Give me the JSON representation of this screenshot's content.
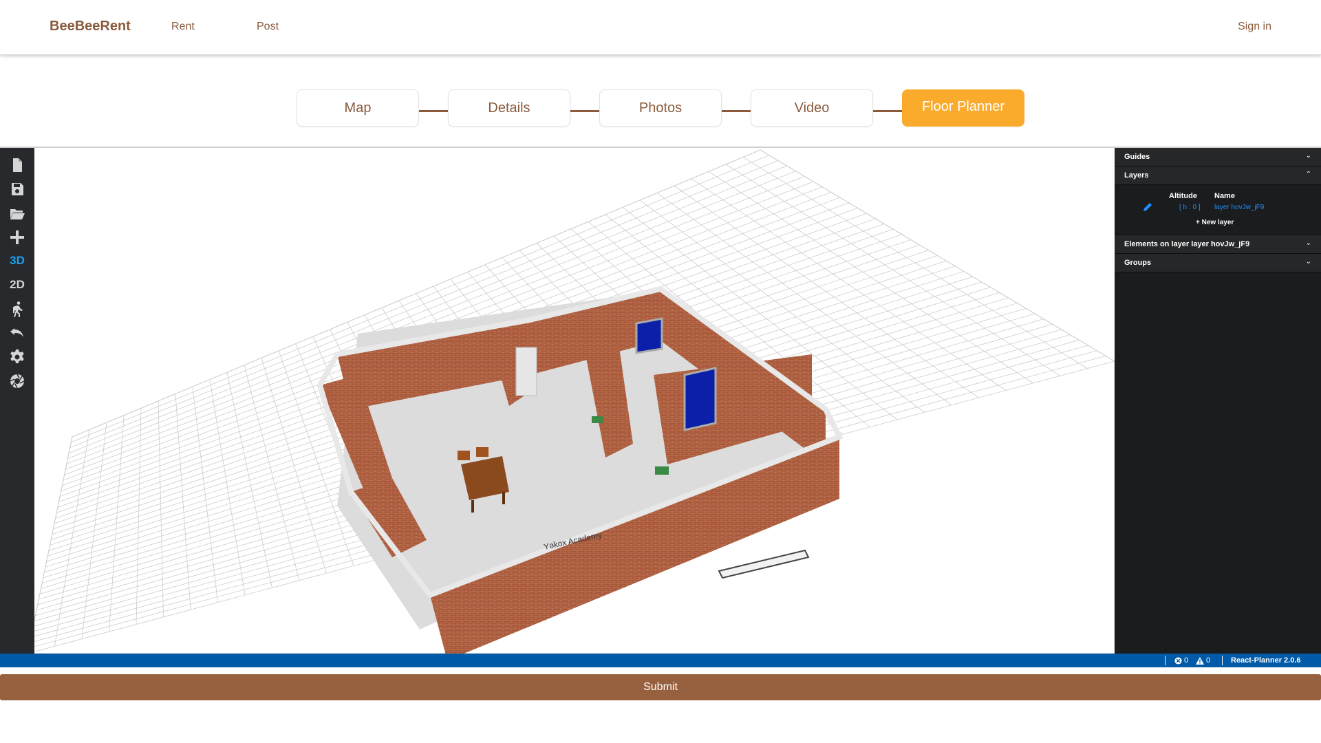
{
  "nav": {
    "brand": "BeeBeeRent",
    "rent": "Rent",
    "post": "Post",
    "signin": "Sign in"
  },
  "steps": [
    {
      "label": "Map",
      "active": false
    },
    {
      "label": "Details",
      "active": false
    },
    {
      "label": "Photos",
      "active": false
    },
    {
      "label": "Video",
      "active": false
    },
    {
      "label": "Floor Planner",
      "active": true
    }
  ],
  "toolbar": {
    "items": [
      {
        "name": "new-project-icon"
      },
      {
        "name": "save-project-icon"
      },
      {
        "name": "open-project-icon"
      },
      {
        "name": "add-element-icon"
      },
      {
        "name": "view-3d",
        "label": "3D",
        "active": true
      },
      {
        "name": "view-2d",
        "label": "2D",
        "active": false
      },
      {
        "name": "first-person-icon"
      },
      {
        "name": "undo-icon"
      },
      {
        "name": "settings-icon"
      },
      {
        "name": "screenshot-icon"
      }
    ]
  },
  "viewport": {
    "room_label": "Yəkox Academy"
  },
  "sidebar": {
    "guides": "Guides",
    "layers": "Layers",
    "altitude_header": "Altitude",
    "name_header": "Name",
    "altitude_value": "[ h : 0 ]",
    "layer_name": "layer hovJw_jF9",
    "new_layer": "New layer",
    "elements": "Elements on layer layer hovJw_jF9",
    "groups": "Groups"
  },
  "statusbar": {
    "errors": "0",
    "warnings": "0",
    "version": "React-Planner 2.0.6"
  },
  "submit": "Submit",
  "colors": {
    "accent": "#fbab2b",
    "brand": "#8b5a3c",
    "submit": "#97603e",
    "status": "#005aa7",
    "brick": "#a8583a"
  }
}
